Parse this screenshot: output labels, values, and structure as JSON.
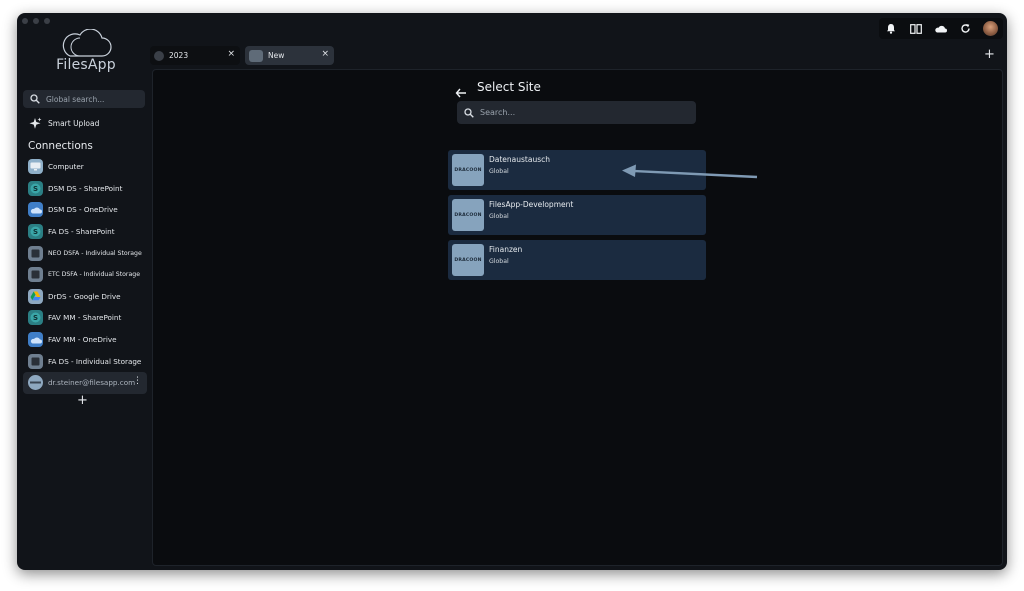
{
  "app": {
    "name": "FilesApp"
  },
  "sidebar": {
    "search_placeholder": "Global search...",
    "smart_upload_label": "Smart Upload",
    "connections_title": "Connections",
    "connections": [
      {
        "label": "Computer",
        "icon": "computer-icon"
      },
      {
        "label": "DSM DS - SharePoint",
        "icon": "sharepoint-icon"
      },
      {
        "label": "DSM DS - OneDrive",
        "icon": "onedrive-icon"
      },
      {
        "label": "FA DS - SharePoint",
        "icon": "sharepoint-icon"
      },
      {
        "label": "NEO DSFA - Individual Storage",
        "icon": "storage-icon"
      },
      {
        "label": "ETC DSFA - Individual Storage",
        "icon": "storage-icon"
      },
      {
        "label": "DrDS - Google Drive",
        "icon": "google-drive-icon"
      },
      {
        "label": "FAV MM - SharePoint",
        "icon": "sharepoint-icon"
      },
      {
        "label": "FAV MM - OneDrive",
        "icon": "onedrive-icon"
      },
      {
        "label": "FA DS - Individual Storage",
        "icon": "storage-icon"
      },
      {
        "label": "dr.steiner@filesapp.com",
        "icon": "account-icon"
      }
    ],
    "add_label": "+"
  },
  "tabs": [
    {
      "label": "2023",
      "close": "×"
    },
    {
      "label": "New",
      "close": "×"
    }
  ],
  "add_tab_label": "+",
  "topbar": {
    "icons": [
      "bell-icon",
      "columns-icon",
      "cloud-icon",
      "refresh-icon",
      "avatar"
    ]
  },
  "main": {
    "title": "Select Site",
    "search_placeholder": "Search...",
    "sites": [
      {
        "name": "Datenaustausch",
        "scope": "Global",
        "thumb_text": "DRACOON"
      },
      {
        "name": "FilesApp-Development",
        "scope": "Global",
        "thumb_text": "DRACOON"
      },
      {
        "name": "Finanzen",
        "scope": "Global",
        "thumb_text": "DRACOON"
      }
    ]
  },
  "colors": {
    "window_bg": "#111419",
    "main_bg": "#0a0c0f",
    "card_bg": "#1b2b40",
    "thumb_bg": "#86a3bd",
    "pointer_arrow": "#7f9ab4"
  }
}
